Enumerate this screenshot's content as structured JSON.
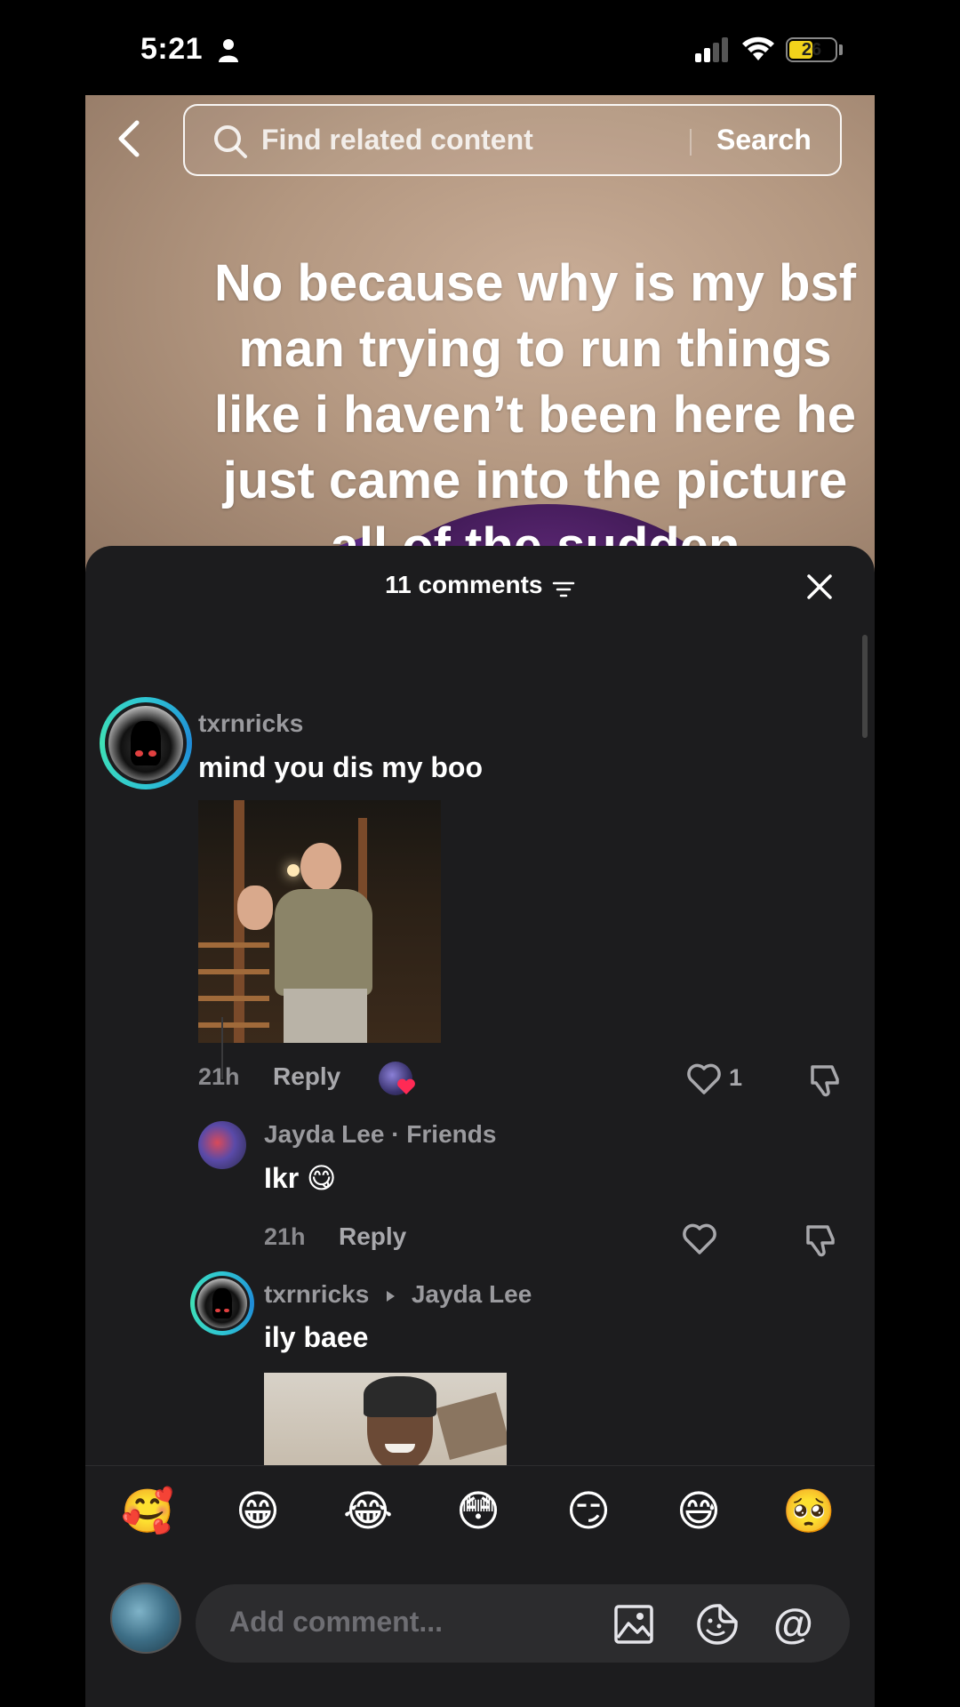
{
  "status_bar": {
    "time": "5:21",
    "battery_level": "26"
  },
  "video": {
    "search_placeholder": "Find related content",
    "search_button": "Search",
    "caption": "No because why is my bsf man trying to run things like i haven’t been here he just came into the picture all of the sudden"
  },
  "comments_sheet": {
    "count_label": "11 comments",
    "comments": [
      {
        "username": "txrnricks",
        "text": "mind you dis my boo",
        "time": "21h",
        "reply_label": "Reply",
        "like_count": "1"
      },
      {
        "username": "Jayda Lee",
        "username_suffix": " · Friends",
        "text": "Ikr 😋",
        "time": "21h",
        "reply_label": "Reply"
      },
      {
        "username": "txrnricks",
        "reply_to": "Jayda Lee",
        "text": "ily baee"
      }
    ]
  },
  "emoji_bar": [
    "🥰",
    "😁",
    "😂",
    "😳",
    "😏",
    "😅",
    "🥺"
  ],
  "comment_input": {
    "placeholder": "Add comment..."
  },
  "colors": {
    "sheet_background": "#1c1c1e",
    "avatar_ring": "#2ec5d3",
    "battery": "#f2d31b"
  },
  "icons": [
    "back-arrow-icon",
    "search-icon",
    "sort-icon",
    "close-icon",
    "heart-icon",
    "dislike-icon",
    "image-icon",
    "sticker-icon",
    "at-icon"
  ]
}
